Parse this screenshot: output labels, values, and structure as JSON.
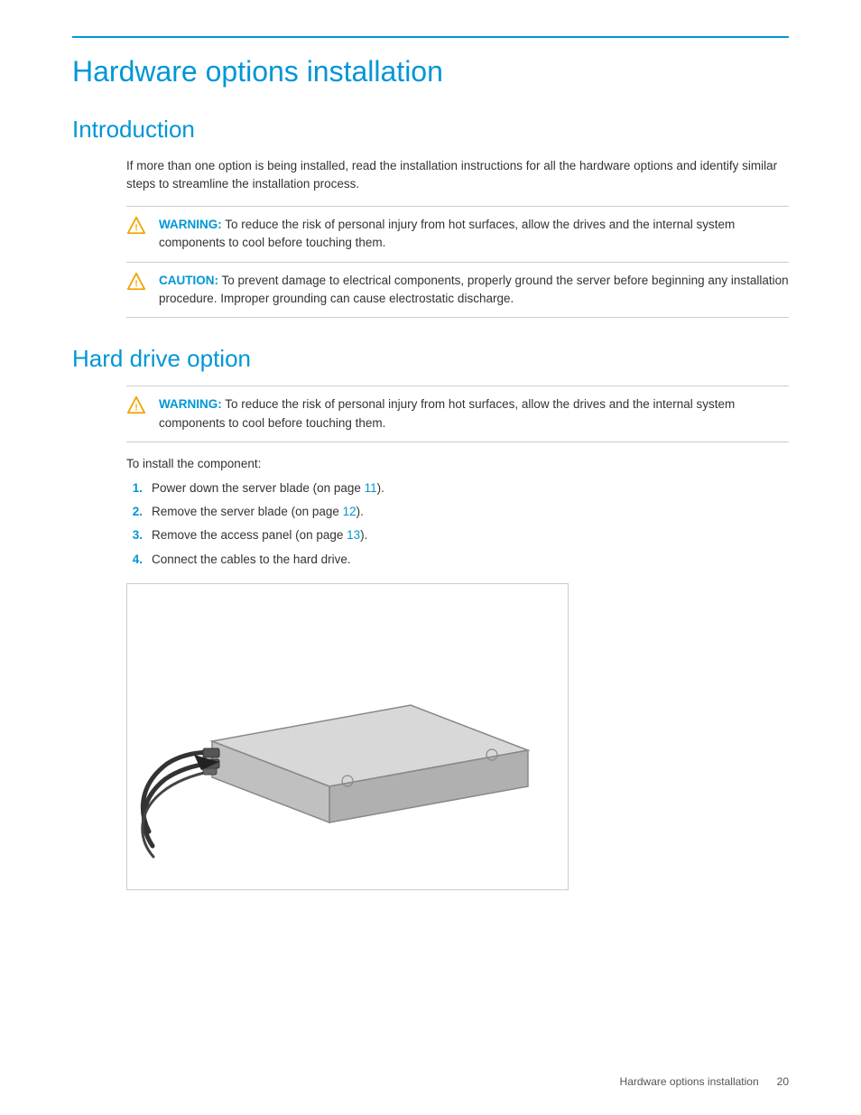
{
  "page": {
    "title": "Hardware options installation",
    "top_rule_color": "#0096d6"
  },
  "introduction": {
    "title": "Introduction",
    "body": "If more than one option is being installed, read the installation instructions for all the hardware options and identify similar steps to streamline the installation process.",
    "warning": {
      "label": "WARNING:",
      "text": "To reduce the risk of personal injury from hot surfaces, allow the drives and the internal system components to cool before touching them."
    },
    "caution": {
      "label": "CAUTION:",
      "text": "To prevent damage to electrical components, properly ground the server before beginning any installation procedure. Improper grounding can cause electrostatic discharge."
    }
  },
  "hard_drive_option": {
    "title": "Hard drive option",
    "warning": {
      "label": "WARNING:",
      "text": "To reduce the risk of personal injury from hot surfaces, allow the drives and the internal system components to cool before touching them."
    },
    "install_intro": "To install the component:",
    "steps": [
      {
        "num": "1.",
        "text": "Power down the server blade (on page ",
        "link_text": "11",
        "text_after": ")."
      },
      {
        "num": "2.",
        "text": "Remove the server blade (on page ",
        "link_text": "12",
        "text_after": ")."
      },
      {
        "num": "3.",
        "text": "Remove the access panel (on page ",
        "link_text": "13",
        "text_after": ")."
      },
      {
        "num": "4.",
        "text": "Connect the cables to the hard drive.",
        "link_text": "",
        "text_after": ""
      }
    ]
  },
  "footer": {
    "section": "Hardware options installation",
    "page": "20"
  }
}
